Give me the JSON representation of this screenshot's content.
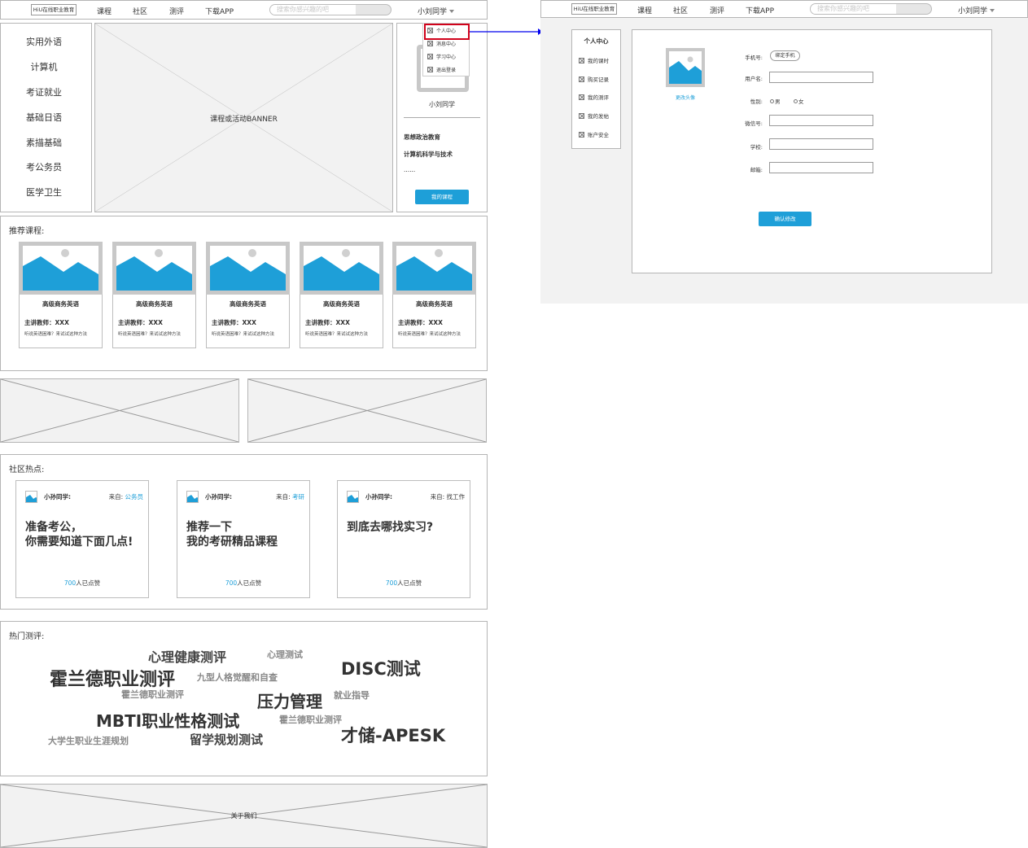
{
  "nav": {
    "logo": "HiU在线职业教育",
    "links": [
      "课程",
      "社区",
      "测评",
      "下载APP"
    ],
    "search_placeholder": "搜索你感兴趣的吧",
    "user": "小刘同学"
  },
  "categories": [
    "实用外语",
    "计算机",
    "考证就业",
    "基础日语",
    "素描基础",
    "考公务员",
    "医学卫生"
  ],
  "banner": {
    "label": "课程或活动BANNER"
  },
  "user_panel": {
    "name": "小刘同学",
    "courses": [
      "思想政治教育",
      "计算机科学与技术",
      "......"
    ],
    "my_course_button": "我的课程"
  },
  "dropdown": {
    "items": [
      "个人中心",
      "消息中心",
      "学习中心",
      "退出登录"
    ]
  },
  "recommend": {
    "heading": "推荐课程:",
    "courses": [
      {
        "title": "高级商务英语",
        "teacher": "主讲教师：XXX",
        "desc": "听说英语困难？来试试这种方法"
      },
      {
        "title": "高级商务英语",
        "teacher": "主讲教师：XXX",
        "desc": "听说英语困难？来试试这种方法"
      },
      {
        "title": "高级商务英语",
        "teacher": "主讲教师：XXX",
        "desc": "听说英语困难？来试试这种方法"
      },
      {
        "title": "高级商务英语",
        "teacher": "主讲教师：XXX",
        "desc": "听说英语困难？来试试这种方法"
      },
      {
        "title": "高级商务英语",
        "teacher": "主讲教师：XXX",
        "desc": "听说英语困难？来试试这种方法"
      }
    ]
  },
  "community": {
    "heading": "社区热点:",
    "posts": [
      {
        "user": "小孙同学:",
        "from_label": "来自:",
        "from": "公务员",
        "from_highlight": true,
        "title_lines": [
          "准备考公，",
          "你需要知道下面几点!"
        ],
        "likes_count": "700",
        "likes_suffix": "人已点赞"
      },
      {
        "user": "小孙同学:",
        "from_label": "来自:",
        "from": "考研",
        "from_highlight": true,
        "title_lines": [
          "推荐一下",
          "我的考研精品课程"
        ],
        "likes_count": "700",
        "likes_suffix": "人已点赞"
      },
      {
        "user": "小孙同学:",
        "from_label": "来自:",
        "from": "找工作",
        "from_highlight": false,
        "title_lines": [
          "到底去哪找实习?",
          ""
        ],
        "likes_count": "700",
        "likes_suffix": "人已点赞"
      }
    ]
  },
  "assessment": {
    "heading": "热门测评:",
    "tags": [
      "心理健康测评",
      "心理测试",
      "霍兰德职业测评",
      "九型人格觉醒和自查",
      "DISC测试",
      "霍兰德职业测评",
      "压力管理",
      "就业指导",
      "MBTI职业性格测试",
      "霍兰德职业测评",
      "大学生职业生涯规划",
      "留学规划测试",
      "才储-APESK"
    ]
  },
  "footer": {
    "label": "关于我们"
  },
  "profile": {
    "sidebar_title": "个人中心",
    "sidebar_items": [
      "我的课时",
      "购买记录",
      "我的测评",
      "我的发帖",
      "账户安全"
    ],
    "change_avatar": "更改头像",
    "phone_label": "手机号:",
    "bind_phone": "绑定手机",
    "username_label": "用户名:",
    "gender_label": "性别:",
    "gender_options": [
      "男",
      "女"
    ],
    "wechat_label": "微信号:",
    "school_label": "学校:",
    "email_label": "邮箱:",
    "confirm_button": "确认修改"
  },
  "colors": {
    "accent": "#1e9fd8",
    "highlight_border": "#d0021b",
    "connector": "#0000ee"
  }
}
